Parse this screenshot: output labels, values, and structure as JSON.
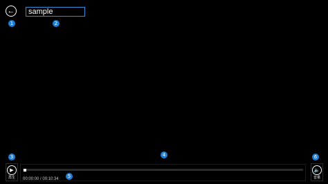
{
  "header": {
    "title": "sample",
    "back_icon": "arrow-left-icon"
  },
  "player": {
    "play_label": "再生",
    "volume_label": "音量",
    "time_text": "00:00:00 / 00:10:34",
    "progress_fraction": 0.0
  },
  "badges": [
    "1",
    "2",
    "3",
    "4",
    "5",
    "6"
  ],
  "colors": {
    "accent": "#1e7fd6",
    "title_border": "#2f8fd8",
    "background": "#000000"
  }
}
